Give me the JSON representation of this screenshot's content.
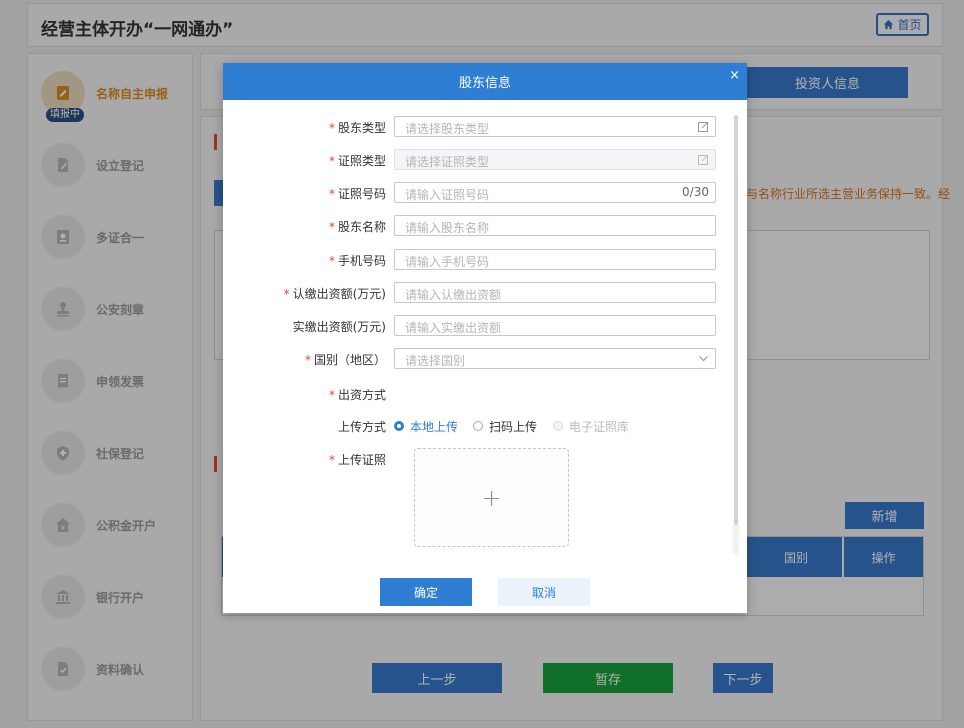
{
  "header": {
    "title": "经营主体开办“一网通办”",
    "home_label": "首页"
  },
  "sidebar": {
    "status_badge": "填报中",
    "steps": [
      {
        "label": "名称自主申报",
        "icon": "form-edit-icon",
        "active": true
      },
      {
        "label": "设立登记",
        "icon": "document-edit-icon",
        "active": false
      },
      {
        "label": "多证合一",
        "icon": "certificate-icon",
        "active": false
      },
      {
        "label": "公安刻章",
        "icon": "stamp-icon",
        "active": false
      },
      {
        "label": "申领发票",
        "icon": "invoice-icon",
        "active": false
      },
      {
        "label": "社保登记",
        "icon": "shield-icon",
        "active": false
      },
      {
        "label": "公积金开户",
        "icon": "fund-icon",
        "active": false
      },
      {
        "label": "银行开户",
        "icon": "bank-icon",
        "active": false
      },
      {
        "label": "资料确认",
        "icon": "file-confirm-icon",
        "active": false
      }
    ]
  },
  "main": {
    "tab_investor": "投资人信息",
    "note_tail": "与名称行业所选主营业务保持一致。经",
    "add_button": "新增",
    "table_headers": [
      "国别",
      "操作"
    ],
    "buttons": {
      "prev": "上一步",
      "save": "暂存",
      "next": "下一步"
    }
  },
  "modal": {
    "title": "股东信息",
    "close": "×",
    "fields": [
      {
        "label": "股东类型",
        "required": true,
        "placeholder": "请选择股东类型",
        "kind": "select-edit",
        "disabled": false
      },
      {
        "label": "证照类型",
        "required": true,
        "placeholder": "请选择证照类型",
        "kind": "select-edit",
        "disabled": true
      },
      {
        "label": "证照号码",
        "required": true,
        "placeholder": "请输入证照号码",
        "kind": "text-count",
        "count": "0/30",
        "disabled": false
      },
      {
        "label": "股东名称",
        "required": true,
        "placeholder": "请输入股东名称",
        "kind": "text",
        "disabled": false
      },
      {
        "label": "手机号码",
        "required": true,
        "placeholder": "请输入手机号码",
        "kind": "text",
        "disabled": false
      },
      {
        "label": "认缴出资额(万元)",
        "required": true,
        "placeholder": "请输入认缴出资额",
        "kind": "text",
        "disabled": false
      },
      {
        "label": "实缴出资额(万元)",
        "required": false,
        "placeholder": "请输入实缴出资额",
        "kind": "text",
        "disabled": false
      },
      {
        "label": "国别（地区）",
        "required": true,
        "placeholder": "请选择国别",
        "kind": "select-arrow",
        "disabled": false
      }
    ],
    "contribution_label": "出资方式",
    "upload_method_label": "上传方式",
    "upload_options": [
      {
        "label": "本地上传",
        "checked": true,
        "disabled": false
      },
      {
        "label": "扫码上传",
        "checked": false,
        "disabled": false
      },
      {
        "label": "电子证照库",
        "checked": false,
        "disabled": true
      }
    ],
    "upload_label": "上传证照",
    "upload_plus": "+",
    "confirm": "确定",
    "cancel": "取消"
  },
  "colors": {
    "primary": "#2e7fd4",
    "sidebar_active": "#d88c25",
    "required": "#e8472a",
    "save_green": "#17a03a"
  }
}
